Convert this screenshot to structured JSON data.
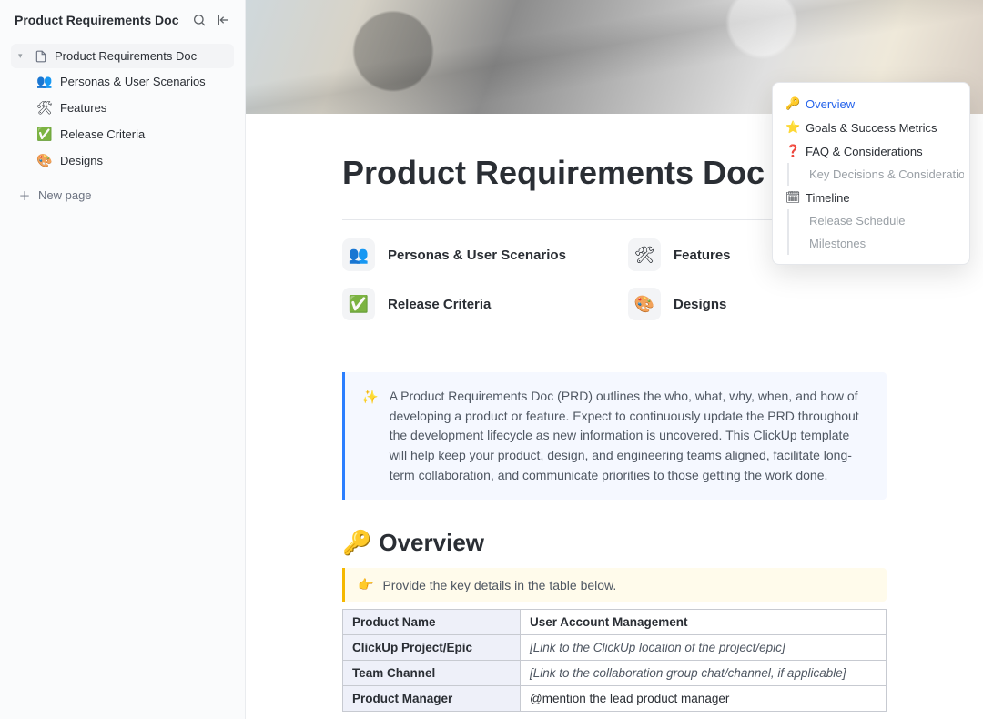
{
  "sidebar": {
    "title": "Product Requirements Doc",
    "root": "Product Requirements Doc",
    "children": [
      {
        "emoji": "👥",
        "label": "Personas & User Scenarios"
      },
      {
        "emoji": "🛠",
        "label": "Features"
      },
      {
        "emoji": "✅",
        "label": "Release Criteria"
      },
      {
        "emoji": "🎨",
        "label": "Designs"
      }
    ],
    "new_page": "New page"
  },
  "doc": {
    "title": "Product Requirements Doc",
    "subpages": [
      {
        "emoji": "👥",
        "label": "Personas & User Scenarios"
      },
      {
        "emoji": "🛠",
        "label": "Features"
      },
      {
        "emoji": "✅",
        "label": "Release Criteria"
      },
      {
        "emoji": "🎨",
        "label": "Designs"
      }
    ],
    "callout": {
      "icon": "✨",
      "text": "A Product Requirements Doc (PRD) outlines the who, what, why, when, and how of developing a product or feature. Expect to continuously update the PRD throughout the development lifecycle as new information is uncovered. This ClickUp template will help keep your product, design, and engineering teams aligned, facilitate long-term collaboration, and communicate priorities to those getting the work done."
    },
    "overview": {
      "icon": "🔑",
      "title": "Overview",
      "note_icon": "👉",
      "note": "Provide the key details in the table below.",
      "rows": [
        {
          "key": "Product Name",
          "val": "User Account Management",
          "bold": true
        },
        {
          "key": "ClickUp Project/Epic",
          "val": "[Link to the ClickUp location of the project/epic]",
          "italic": true
        },
        {
          "key": "Team Channel",
          "val": "[Link to the collaboration group chat/channel, if applicable]",
          "italic": true
        },
        {
          "key": "Product Manager",
          "val": "@mention the lead product manager"
        }
      ]
    }
  },
  "outline": [
    {
      "icon": "🔑",
      "label": "Overview",
      "active": true
    },
    {
      "icon": "⭐",
      "label": "Goals & Success Metrics"
    },
    {
      "icon": "❓",
      "label": "FAQ & Considerations"
    },
    {
      "label": "Key Decisions & Consideratio…",
      "sub": true
    },
    {
      "icon": "🗓",
      "label": "Timeline"
    },
    {
      "label": "Release Schedule",
      "sub": true
    },
    {
      "label": "Milestones",
      "sub": true
    }
  ]
}
